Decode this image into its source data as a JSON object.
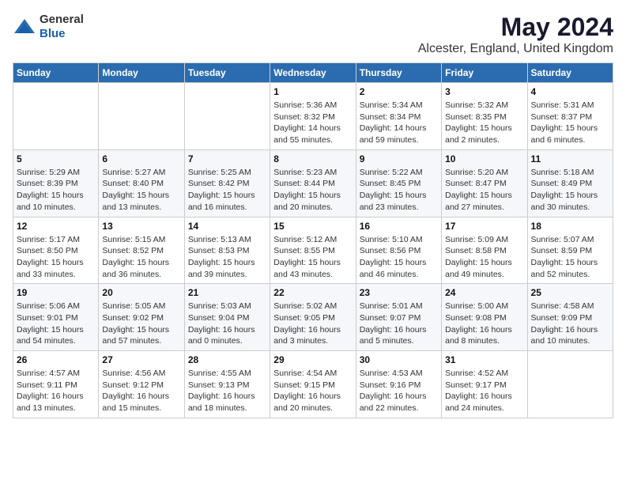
{
  "header": {
    "logo": {
      "general": "General",
      "blue": "Blue"
    },
    "title": "May 2024",
    "location": "Alcester, England, United Kingdom"
  },
  "days_of_week": [
    "Sunday",
    "Monday",
    "Tuesday",
    "Wednesday",
    "Thursday",
    "Friday",
    "Saturday"
  ],
  "weeks": [
    [
      {
        "day": "",
        "info": ""
      },
      {
        "day": "",
        "info": ""
      },
      {
        "day": "",
        "info": ""
      },
      {
        "day": "1",
        "info": "Sunrise: 5:36 AM\nSunset: 8:32 PM\nDaylight: 14 hours\nand 55 minutes."
      },
      {
        "day": "2",
        "info": "Sunrise: 5:34 AM\nSunset: 8:34 PM\nDaylight: 14 hours\nand 59 minutes."
      },
      {
        "day": "3",
        "info": "Sunrise: 5:32 AM\nSunset: 8:35 PM\nDaylight: 15 hours\nand 2 minutes."
      },
      {
        "day": "4",
        "info": "Sunrise: 5:31 AM\nSunset: 8:37 PM\nDaylight: 15 hours\nand 6 minutes."
      }
    ],
    [
      {
        "day": "5",
        "info": "Sunrise: 5:29 AM\nSunset: 8:39 PM\nDaylight: 15 hours\nand 10 minutes."
      },
      {
        "day": "6",
        "info": "Sunrise: 5:27 AM\nSunset: 8:40 PM\nDaylight: 15 hours\nand 13 minutes."
      },
      {
        "day": "7",
        "info": "Sunrise: 5:25 AM\nSunset: 8:42 PM\nDaylight: 15 hours\nand 16 minutes."
      },
      {
        "day": "8",
        "info": "Sunrise: 5:23 AM\nSunset: 8:44 PM\nDaylight: 15 hours\nand 20 minutes."
      },
      {
        "day": "9",
        "info": "Sunrise: 5:22 AM\nSunset: 8:45 PM\nDaylight: 15 hours\nand 23 minutes."
      },
      {
        "day": "10",
        "info": "Sunrise: 5:20 AM\nSunset: 8:47 PM\nDaylight: 15 hours\nand 27 minutes."
      },
      {
        "day": "11",
        "info": "Sunrise: 5:18 AM\nSunset: 8:49 PM\nDaylight: 15 hours\nand 30 minutes."
      }
    ],
    [
      {
        "day": "12",
        "info": "Sunrise: 5:17 AM\nSunset: 8:50 PM\nDaylight: 15 hours\nand 33 minutes."
      },
      {
        "day": "13",
        "info": "Sunrise: 5:15 AM\nSunset: 8:52 PM\nDaylight: 15 hours\nand 36 minutes."
      },
      {
        "day": "14",
        "info": "Sunrise: 5:13 AM\nSunset: 8:53 PM\nDaylight: 15 hours\nand 39 minutes."
      },
      {
        "day": "15",
        "info": "Sunrise: 5:12 AM\nSunset: 8:55 PM\nDaylight: 15 hours\nand 43 minutes."
      },
      {
        "day": "16",
        "info": "Sunrise: 5:10 AM\nSunset: 8:56 PM\nDaylight: 15 hours\nand 46 minutes."
      },
      {
        "day": "17",
        "info": "Sunrise: 5:09 AM\nSunset: 8:58 PM\nDaylight: 15 hours\nand 49 minutes."
      },
      {
        "day": "18",
        "info": "Sunrise: 5:07 AM\nSunset: 8:59 PM\nDaylight: 15 hours\nand 52 minutes."
      }
    ],
    [
      {
        "day": "19",
        "info": "Sunrise: 5:06 AM\nSunset: 9:01 PM\nDaylight: 15 hours\nand 54 minutes."
      },
      {
        "day": "20",
        "info": "Sunrise: 5:05 AM\nSunset: 9:02 PM\nDaylight: 15 hours\nand 57 minutes."
      },
      {
        "day": "21",
        "info": "Sunrise: 5:03 AM\nSunset: 9:04 PM\nDaylight: 16 hours\nand 0 minutes."
      },
      {
        "day": "22",
        "info": "Sunrise: 5:02 AM\nSunset: 9:05 PM\nDaylight: 16 hours\nand 3 minutes."
      },
      {
        "day": "23",
        "info": "Sunrise: 5:01 AM\nSunset: 9:07 PM\nDaylight: 16 hours\nand 5 minutes."
      },
      {
        "day": "24",
        "info": "Sunrise: 5:00 AM\nSunset: 9:08 PM\nDaylight: 16 hours\nand 8 minutes."
      },
      {
        "day": "25",
        "info": "Sunrise: 4:58 AM\nSunset: 9:09 PM\nDaylight: 16 hours\nand 10 minutes."
      }
    ],
    [
      {
        "day": "26",
        "info": "Sunrise: 4:57 AM\nSunset: 9:11 PM\nDaylight: 16 hours\nand 13 minutes."
      },
      {
        "day": "27",
        "info": "Sunrise: 4:56 AM\nSunset: 9:12 PM\nDaylight: 16 hours\nand 15 minutes."
      },
      {
        "day": "28",
        "info": "Sunrise: 4:55 AM\nSunset: 9:13 PM\nDaylight: 16 hours\nand 18 minutes."
      },
      {
        "day": "29",
        "info": "Sunrise: 4:54 AM\nSunset: 9:15 PM\nDaylight: 16 hours\nand 20 minutes."
      },
      {
        "day": "30",
        "info": "Sunrise: 4:53 AM\nSunset: 9:16 PM\nDaylight: 16 hours\nand 22 minutes."
      },
      {
        "day": "31",
        "info": "Sunrise: 4:52 AM\nSunset: 9:17 PM\nDaylight: 16 hours\nand 24 minutes."
      },
      {
        "day": "",
        "info": ""
      }
    ]
  ]
}
